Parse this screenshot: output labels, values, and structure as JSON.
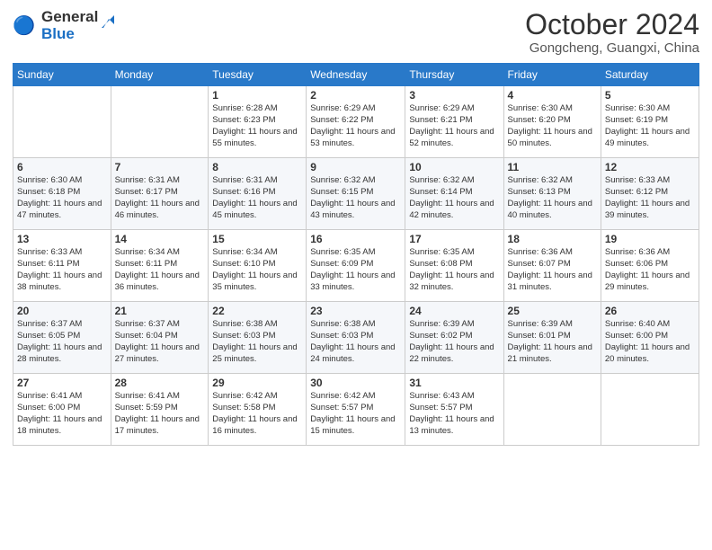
{
  "header": {
    "logo_general": "General",
    "logo_blue": "Blue",
    "month": "October 2024",
    "location": "Gongcheng, Guangxi, China"
  },
  "days_of_week": [
    "Sunday",
    "Monday",
    "Tuesday",
    "Wednesday",
    "Thursday",
    "Friday",
    "Saturday"
  ],
  "weeks": [
    [
      {
        "num": "",
        "info": ""
      },
      {
        "num": "",
        "info": ""
      },
      {
        "num": "1",
        "info": "Sunrise: 6:28 AM\nSunset: 6:23 PM\nDaylight: 11 hours and 55 minutes."
      },
      {
        "num": "2",
        "info": "Sunrise: 6:29 AM\nSunset: 6:22 PM\nDaylight: 11 hours and 53 minutes."
      },
      {
        "num": "3",
        "info": "Sunrise: 6:29 AM\nSunset: 6:21 PM\nDaylight: 11 hours and 52 minutes."
      },
      {
        "num": "4",
        "info": "Sunrise: 6:30 AM\nSunset: 6:20 PM\nDaylight: 11 hours and 50 minutes."
      },
      {
        "num": "5",
        "info": "Sunrise: 6:30 AM\nSunset: 6:19 PM\nDaylight: 11 hours and 49 minutes."
      }
    ],
    [
      {
        "num": "6",
        "info": "Sunrise: 6:30 AM\nSunset: 6:18 PM\nDaylight: 11 hours and 47 minutes."
      },
      {
        "num": "7",
        "info": "Sunrise: 6:31 AM\nSunset: 6:17 PM\nDaylight: 11 hours and 46 minutes."
      },
      {
        "num": "8",
        "info": "Sunrise: 6:31 AM\nSunset: 6:16 PM\nDaylight: 11 hours and 45 minutes."
      },
      {
        "num": "9",
        "info": "Sunrise: 6:32 AM\nSunset: 6:15 PM\nDaylight: 11 hours and 43 minutes."
      },
      {
        "num": "10",
        "info": "Sunrise: 6:32 AM\nSunset: 6:14 PM\nDaylight: 11 hours and 42 minutes."
      },
      {
        "num": "11",
        "info": "Sunrise: 6:32 AM\nSunset: 6:13 PM\nDaylight: 11 hours and 40 minutes."
      },
      {
        "num": "12",
        "info": "Sunrise: 6:33 AM\nSunset: 6:12 PM\nDaylight: 11 hours and 39 minutes."
      }
    ],
    [
      {
        "num": "13",
        "info": "Sunrise: 6:33 AM\nSunset: 6:11 PM\nDaylight: 11 hours and 38 minutes."
      },
      {
        "num": "14",
        "info": "Sunrise: 6:34 AM\nSunset: 6:11 PM\nDaylight: 11 hours and 36 minutes."
      },
      {
        "num": "15",
        "info": "Sunrise: 6:34 AM\nSunset: 6:10 PM\nDaylight: 11 hours and 35 minutes."
      },
      {
        "num": "16",
        "info": "Sunrise: 6:35 AM\nSunset: 6:09 PM\nDaylight: 11 hours and 33 minutes."
      },
      {
        "num": "17",
        "info": "Sunrise: 6:35 AM\nSunset: 6:08 PM\nDaylight: 11 hours and 32 minutes."
      },
      {
        "num": "18",
        "info": "Sunrise: 6:36 AM\nSunset: 6:07 PM\nDaylight: 11 hours and 31 minutes."
      },
      {
        "num": "19",
        "info": "Sunrise: 6:36 AM\nSunset: 6:06 PM\nDaylight: 11 hours and 29 minutes."
      }
    ],
    [
      {
        "num": "20",
        "info": "Sunrise: 6:37 AM\nSunset: 6:05 PM\nDaylight: 11 hours and 28 minutes."
      },
      {
        "num": "21",
        "info": "Sunrise: 6:37 AM\nSunset: 6:04 PM\nDaylight: 11 hours and 27 minutes."
      },
      {
        "num": "22",
        "info": "Sunrise: 6:38 AM\nSunset: 6:03 PM\nDaylight: 11 hours and 25 minutes."
      },
      {
        "num": "23",
        "info": "Sunrise: 6:38 AM\nSunset: 6:03 PM\nDaylight: 11 hours and 24 minutes."
      },
      {
        "num": "24",
        "info": "Sunrise: 6:39 AM\nSunset: 6:02 PM\nDaylight: 11 hours and 22 minutes."
      },
      {
        "num": "25",
        "info": "Sunrise: 6:39 AM\nSunset: 6:01 PM\nDaylight: 11 hours and 21 minutes."
      },
      {
        "num": "26",
        "info": "Sunrise: 6:40 AM\nSunset: 6:00 PM\nDaylight: 11 hours and 20 minutes."
      }
    ],
    [
      {
        "num": "27",
        "info": "Sunrise: 6:41 AM\nSunset: 6:00 PM\nDaylight: 11 hours and 18 minutes."
      },
      {
        "num": "28",
        "info": "Sunrise: 6:41 AM\nSunset: 5:59 PM\nDaylight: 11 hours and 17 minutes."
      },
      {
        "num": "29",
        "info": "Sunrise: 6:42 AM\nSunset: 5:58 PM\nDaylight: 11 hours and 16 minutes."
      },
      {
        "num": "30",
        "info": "Sunrise: 6:42 AM\nSunset: 5:57 PM\nDaylight: 11 hours and 15 minutes."
      },
      {
        "num": "31",
        "info": "Sunrise: 6:43 AM\nSunset: 5:57 PM\nDaylight: 11 hours and 13 minutes."
      },
      {
        "num": "",
        "info": ""
      },
      {
        "num": "",
        "info": ""
      }
    ]
  ]
}
